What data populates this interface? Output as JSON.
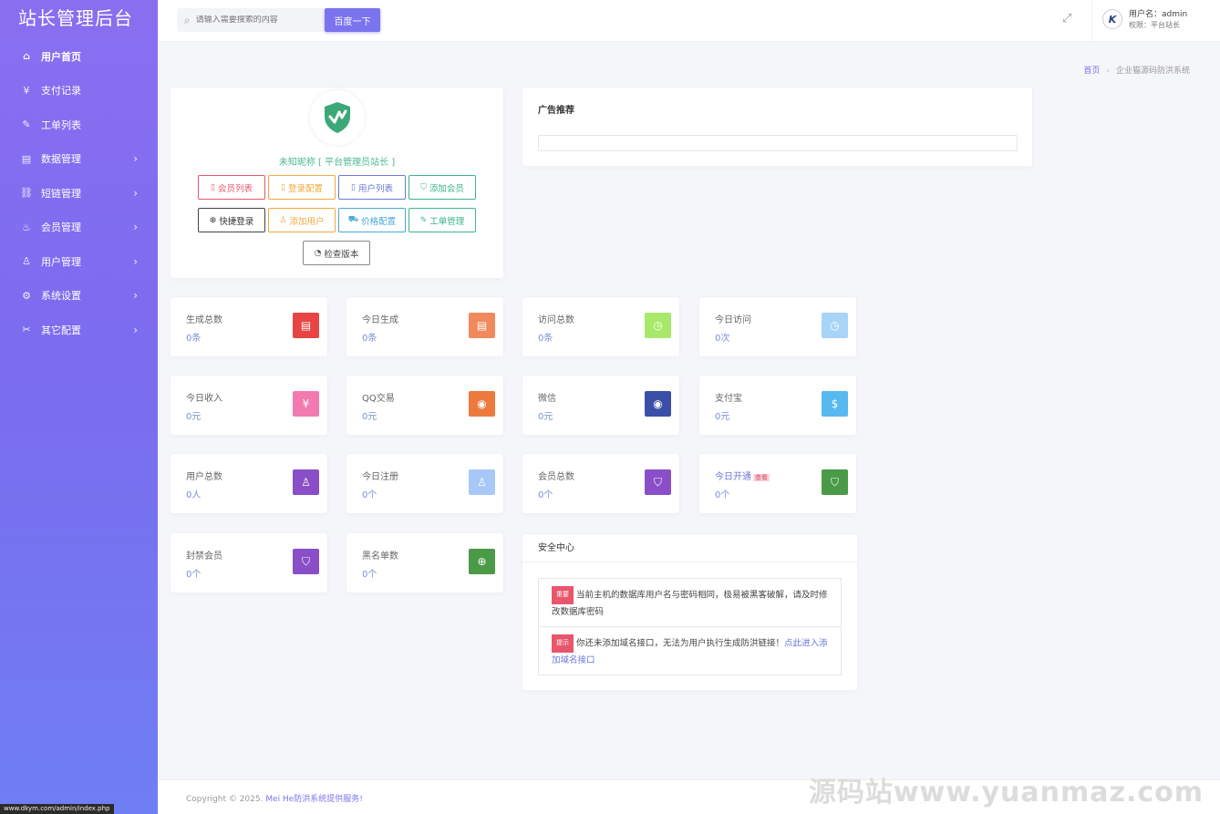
{
  "sidebar": {
    "brand": "站长管理后台",
    "items": [
      {
        "label": "用户首页",
        "icon": "home-icon",
        "glyph": "⌂",
        "chevron": false
      },
      {
        "label": "支付记录",
        "icon": "yen-icon",
        "glyph": "¥",
        "chevron": false
      },
      {
        "label": "工单列表",
        "icon": "ticket-icon",
        "glyph": "✎",
        "chevron": false
      },
      {
        "label": "数据管理",
        "icon": "database-icon",
        "glyph": "▤",
        "chevron": true
      },
      {
        "label": "短链管理",
        "icon": "link-icon",
        "glyph": "⛓",
        "chevron": true
      },
      {
        "label": "会员管理",
        "icon": "fire-icon",
        "glyph": "♨",
        "chevron": true
      },
      {
        "label": "用户管理",
        "icon": "user-icon",
        "glyph": "♙",
        "chevron": true
      },
      {
        "label": "系统设置",
        "icon": "gear-icon",
        "glyph": "⚙",
        "chevron": true
      },
      {
        "label": "其它配置",
        "icon": "tools-icon",
        "glyph": "✂",
        "chevron": true
      }
    ],
    "chevron_glyph": "›"
  },
  "topbar": {
    "search_placeholder": "请输入需要搜索的内容",
    "search_button": "百度一下",
    "username": "用户名：admin",
    "role": "权限：平台站长",
    "avatar_letter": "K"
  },
  "breadcrumb": {
    "home": "首页",
    "sep": "›",
    "current": "企业猫源码防洪系统"
  },
  "profile": {
    "nickname": "未知昵称 [ 平台管理员站长 ]",
    "buttons": [
      {
        "label": "会员列表",
        "glyph": "▯",
        "color": "#e8566c"
      },
      {
        "label": "登录配置",
        "glyph": "▯",
        "color": "#f0a83c"
      },
      {
        "label": "用户列表",
        "glyph": "▯",
        "color": "#6a7ad8"
      },
      {
        "label": "添加会员",
        "glyph": "⛉",
        "color": "#3cb48c"
      },
      {
        "label": "快捷登录",
        "glyph": "⊕",
        "color": "#333333"
      },
      {
        "label": "添加用户",
        "glyph": "♙",
        "color": "#f0a83c"
      },
      {
        "label": "价格配置",
        "glyph": "⛟",
        "color": "#4aa8d8"
      },
      {
        "label": "工单管理",
        "glyph": "✎",
        "color": "#3cb48c"
      }
    ],
    "check_version": "检查版本"
  },
  "ad": {
    "title": "广告推荐"
  },
  "stats": [
    {
      "label": "生成总数",
      "value": "0条",
      "color": "#e84444",
      "glyph": "▤",
      "icon": "document-icon"
    },
    {
      "label": "今日生成",
      "value": "0条",
      "color": "#f08a5d",
      "glyph": "▤",
      "icon": "document-icon"
    },
    {
      "label": "访问总数",
      "value": "0条",
      "color": "#a8e86a",
      "glyph": "◷",
      "icon": "clock-icon"
    },
    {
      "label": "今日访问",
      "value": "0次",
      "color": "#a8d4f8",
      "glyph": "◷",
      "icon": "clock-icon"
    },
    {
      "label": "今日收入",
      "value": "0元",
      "color": "#f27ab0",
      "glyph": "¥",
      "icon": "yen-icon"
    },
    {
      "label": "QQ交易",
      "value": "0元",
      "color": "#ec7a3e",
      "glyph": "◉",
      "icon": "qq-icon"
    },
    {
      "label": "微信",
      "value": "0元",
      "color": "#3b4fa8",
      "glyph": "◉",
      "icon": "wechat-icon"
    },
    {
      "label": "支付宝",
      "value": "0元",
      "color": "#58b8f0",
      "glyph": "$",
      "icon": "alipay-icon"
    },
    {
      "label": "用户总数",
      "value": "0人",
      "color": "#8a4ec8",
      "glyph": "♙",
      "icon": "user-icon"
    },
    {
      "label": "今日注册",
      "value": "0个",
      "color": "#a8c8f8",
      "glyph": "♙",
      "icon": "user-icon"
    },
    {
      "label": "会员总数",
      "value": "0个",
      "color": "#8a4ec8",
      "glyph": "⛉",
      "icon": "shield-icon"
    },
    {
      "label": "今日开通",
      "value": "0个",
      "color": "#4a9a48",
      "glyph": "⛉",
      "icon": "shield-icon",
      "tag": "查看",
      "highlight": true
    },
    {
      "label": "封禁会员",
      "value": "0个",
      "color": "#8a4ec8",
      "glyph": "⛉",
      "icon": "shield-icon"
    },
    {
      "label": "黑名单数",
      "value": "0个",
      "color": "#4a9a48",
      "glyph": "⊕",
      "icon": "globe-icon"
    }
  ],
  "security": {
    "title": "安全中心",
    "alerts": [
      {
        "badge": "重要",
        "text": "当前主机的数据库用户名与密码相同，极易被黑客破解，请及时修改数据库密码",
        "link": ""
      },
      {
        "badge": "提示",
        "text": "你还未添加域名接口，无法为用户执行生成防洪链接！",
        "link": "点此进入添加域名接口"
      }
    ]
  },
  "footer": {
    "prefix": "Copyright © 2025.",
    "highlight": "Mei He防洪系统提供服务!"
  },
  "watermark": "源码站www.yuanmaz.com",
  "statusbar": "www.dkym.com/admin/index.php"
}
